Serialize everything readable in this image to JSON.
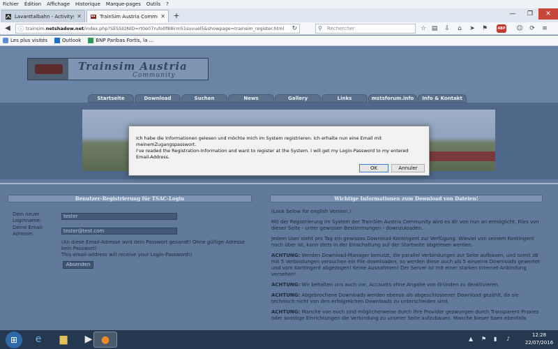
{
  "menubar": {
    "items": [
      "Fichier",
      "Édition",
      "Affichage",
      "Historique",
      "Marque-pages",
      "Outils",
      "?"
    ]
  },
  "tabs": [
    {
      "title": "Lavanttalbahn - Activitysi...",
      "active": false
    },
    {
      "title": "TrainSim Austria Commun...",
      "active": true
    }
  ],
  "window_controls": {
    "minimize": "—",
    "maximize": "❐",
    "close": "✕"
  },
  "navbar": {
    "url_prefix": "trainsim.",
    "url_domain": "netshadow.net",
    "url_rest": "/index.php?SESSIONID=rt0e07rufo0f88irm51suvuel5&showpage=trainsim_register.html",
    "search_placeholder": "Rechercher"
  },
  "bookmarks": [
    {
      "label": "Les plus visités",
      "icon_color": "#5a8fd6"
    },
    {
      "label": "Outlook",
      "icon_color": "#1f6fc5"
    },
    {
      "label": "BNP Paribas Fortis, la ...",
      "icon_color": "#2e9a55"
    }
  ],
  "site": {
    "logo_title": "Trainsim Austria",
    "logo_subtitle": "Community",
    "nav": [
      "Startseite",
      "Download",
      "Suchen",
      "News",
      "Gallery",
      "Links",
      "mstsforum.info",
      "Info & Kontakt"
    ]
  },
  "register": {
    "heading": "Benutzer-Registrierung für TSAC-Login",
    "login_label": "Dein neuer Loginname:",
    "login_value": "tester",
    "email_label": "Deine Email-Adresse:",
    "email_value": "tester@test.com",
    "note": "(An diese Email-Adresse wird dein Passwort gesandt! Ohne gültige Adresse kein Passwort!\nThis email-address will receive your Login-Password!)",
    "submit_label": "Absenden"
  },
  "info": {
    "heading": "Wichtige Informationen zum Download von Dateien!",
    "p1": "(Look below for english Version.)",
    "p2": "Mit der Registrierung im System der TrainSim Austria Community wird es dir von nun an ermöglicht, Files von dieser Seite - unter gewissen Bestimmungen - downzuloaden.",
    "p3": "Jedem User steht pro Tag ein gewisses Download-Kontingent zur Verfügung. Wieviel von seinem Kontingent noch über ist, kann stets in der Einschaltung auf der Startseite abgelesen werden.",
    "p4_bold": "ACHTUNG:",
    "p4_text": " Werden Download-Manager benutzt, die parallel Verbindungen zur Seite aufbauen, und somit zB mit 5 Verbindungen versuchen ein File downloaden, so werden diese auch als 5 einzelne Downloads gewertet und vom Kontingent abgezogen! Keine Ausnahmen! Der Server ist mit einer starken Internet-Anbindung versehen!",
    "p5_bold": "ACHTUNG:",
    "p5_text": " Wir behalten uns auch vor, Accounts ohne Angabe von Gründen zu deaktivieren.",
    "p6_bold": "ACHTUNG:",
    "p6_text": " Abgebrochene Downloads werden ebenso als abgeschlossener Download gezählt, da sie technisch nicht von den erfolgreichen Downloads zu unterscheiden sind.",
    "p7_bold": "ACHTUNG:",
    "p7_text": " Manche von euch sind möglicherweise durch ihre Provider gezwungen durch Transparent-Proxies oder sonstige Einrichtungen die Verbindung zu unserer Seite aufzubauen. Manche bieser baen ebenfalls"
  },
  "dialog": {
    "message_de": "Ich habe die Informationen gelesen und möchte mich im System registrieren. Ich erhalte nun eine Email mit meinemZugangspasswort.",
    "message_en": "I've readed the Registration-Information and want to register at the System. I will get my Login-Password to my entered Email-Address.",
    "ok_label": "OK",
    "cancel_label": "Annuler"
  },
  "taskbar": {
    "time": "12:28",
    "date": "22/07/2016"
  }
}
